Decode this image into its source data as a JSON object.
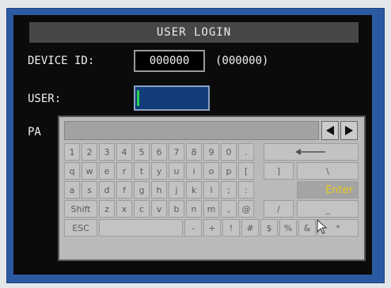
{
  "title": "USER LOGIN",
  "device_id": {
    "label": "DEVICE ID:",
    "value": "000000",
    "hint": "(000000)"
  },
  "user": {
    "label": "USER:",
    "value": ""
  },
  "password": {
    "label_visible": "PA"
  },
  "keyboard": {
    "rows": [
      [
        "1",
        "2",
        "3",
        "4",
        "5",
        "6",
        "7",
        "8",
        "9",
        "0",
        ".",
        "⟵"
      ],
      [
        "q",
        "w",
        "e",
        "r",
        "t",
        "y",
        "u",
        "i",
        "o",
        "p",
        "[",
        "]",
        "\\"
      ],
      [
        "a",
        "s",
        "d",
        "f",
        "g",
        "h",
        "j",
        "k",
        "l",
        ";",
        ":",
        "Enter"
      ],
      [
        "Shift",
        "z",
        "x",
        "c",
        "v",
        "b",
        "n",
        "m",
        ",",
        "@",
        "/",
        "_"
      ],
      [
        "ESC",
        "",
        "-",
        "+",
        "!",
        "#",
        "$",
        "%",
        "&",
        "*"
      ]
    ],
    "selected_key": "Enter"
  },
  "colors": {
    "screen_bg": "#0b0b0b",
    "frame_blue": "#2b5aa3",
    "title_bg": "#474747",
    "user_field_bg": "#123c7a",
    "cursor_green": "#25d24a",
    "keyboard_bg": "#c2c2c2",
    "selected_key_text": "#f0d21e"
  },
  "icons": {
    "left": "caret-left-icon",
    "right": "caret-right-icon",
    "backspace": "backspace-arrow-icon",
    "pointer": "mouse-pointer-icon"
  }
}
